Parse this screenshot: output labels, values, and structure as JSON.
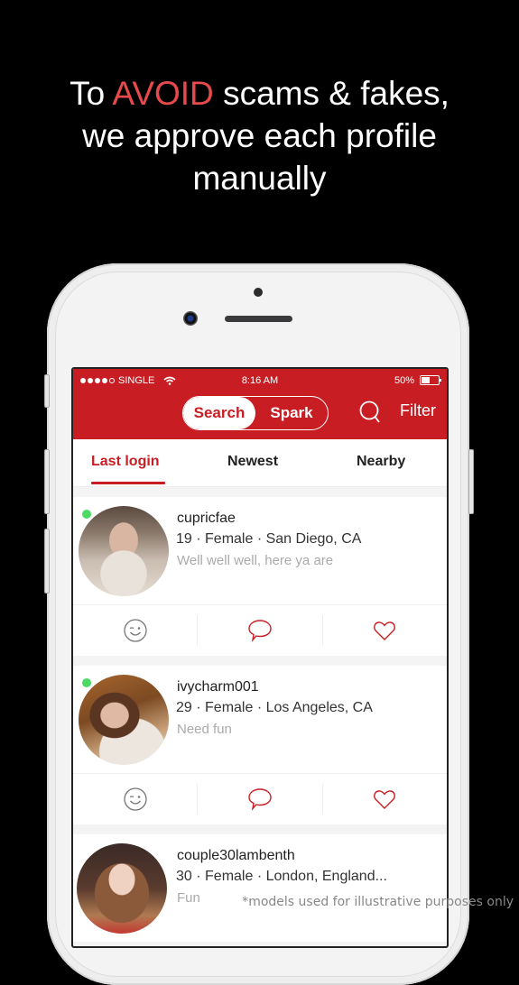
{
  "headline": {
    "prefix": "To ",
    "accent": "AVOID",
    "suffix_line1": " scams & fakes,",
    "line2": "we approve each profile",
    "line3": "manually"
  },
  "colors": {
    "brand": "#c81d23",
    "accent": "#e8494a",
    "online": "#4cd964"
  },
  "status_bar": {
    "carrier": "SINGLE",
    "time": "8:16 AM",
    "battery": "50%",
    "battery_level": 0.5,
    "signal_bars": 4
  },
  "navbar": {
    "segments": [
      {
        "label": "Search",
        "active": true
      },
      {
        "label": "Spark",
        "active": false
      }
    ],
    "search_icon": "search-icon",
    "filter_label": "Filter"
  },
  "tabs": [
    {
      "label": "Last login",
      "active": true
    },
    {
      "label": "Newest",
      "active": false
    },
    {
      "label": "Nearby",
      "active": false
    }
  ],
  "profiles": [
    {
      "username": "cupricfae",
      "meta": "19 · Female · San Diego, CA",
      "bio": "Well well well, here ya are",
      "online": true
    },
    {
      "username": "ivycharm001",
      "meta": "29 · Female · Los Angeles, CA",
      "bio": "Need fun",
      "online": true
    },
    {
      "username": "couple30lambenth",
      "meta": "30 · Female · London, England...",
      "bio": "Fun",
      "online": false
    }
  ],
  "card_actions": [
    "wink-icon",
    "message-icon",
    "heart-icon"
  ],
  "disclaimer": "*models used for illustrative purposes only"
}
